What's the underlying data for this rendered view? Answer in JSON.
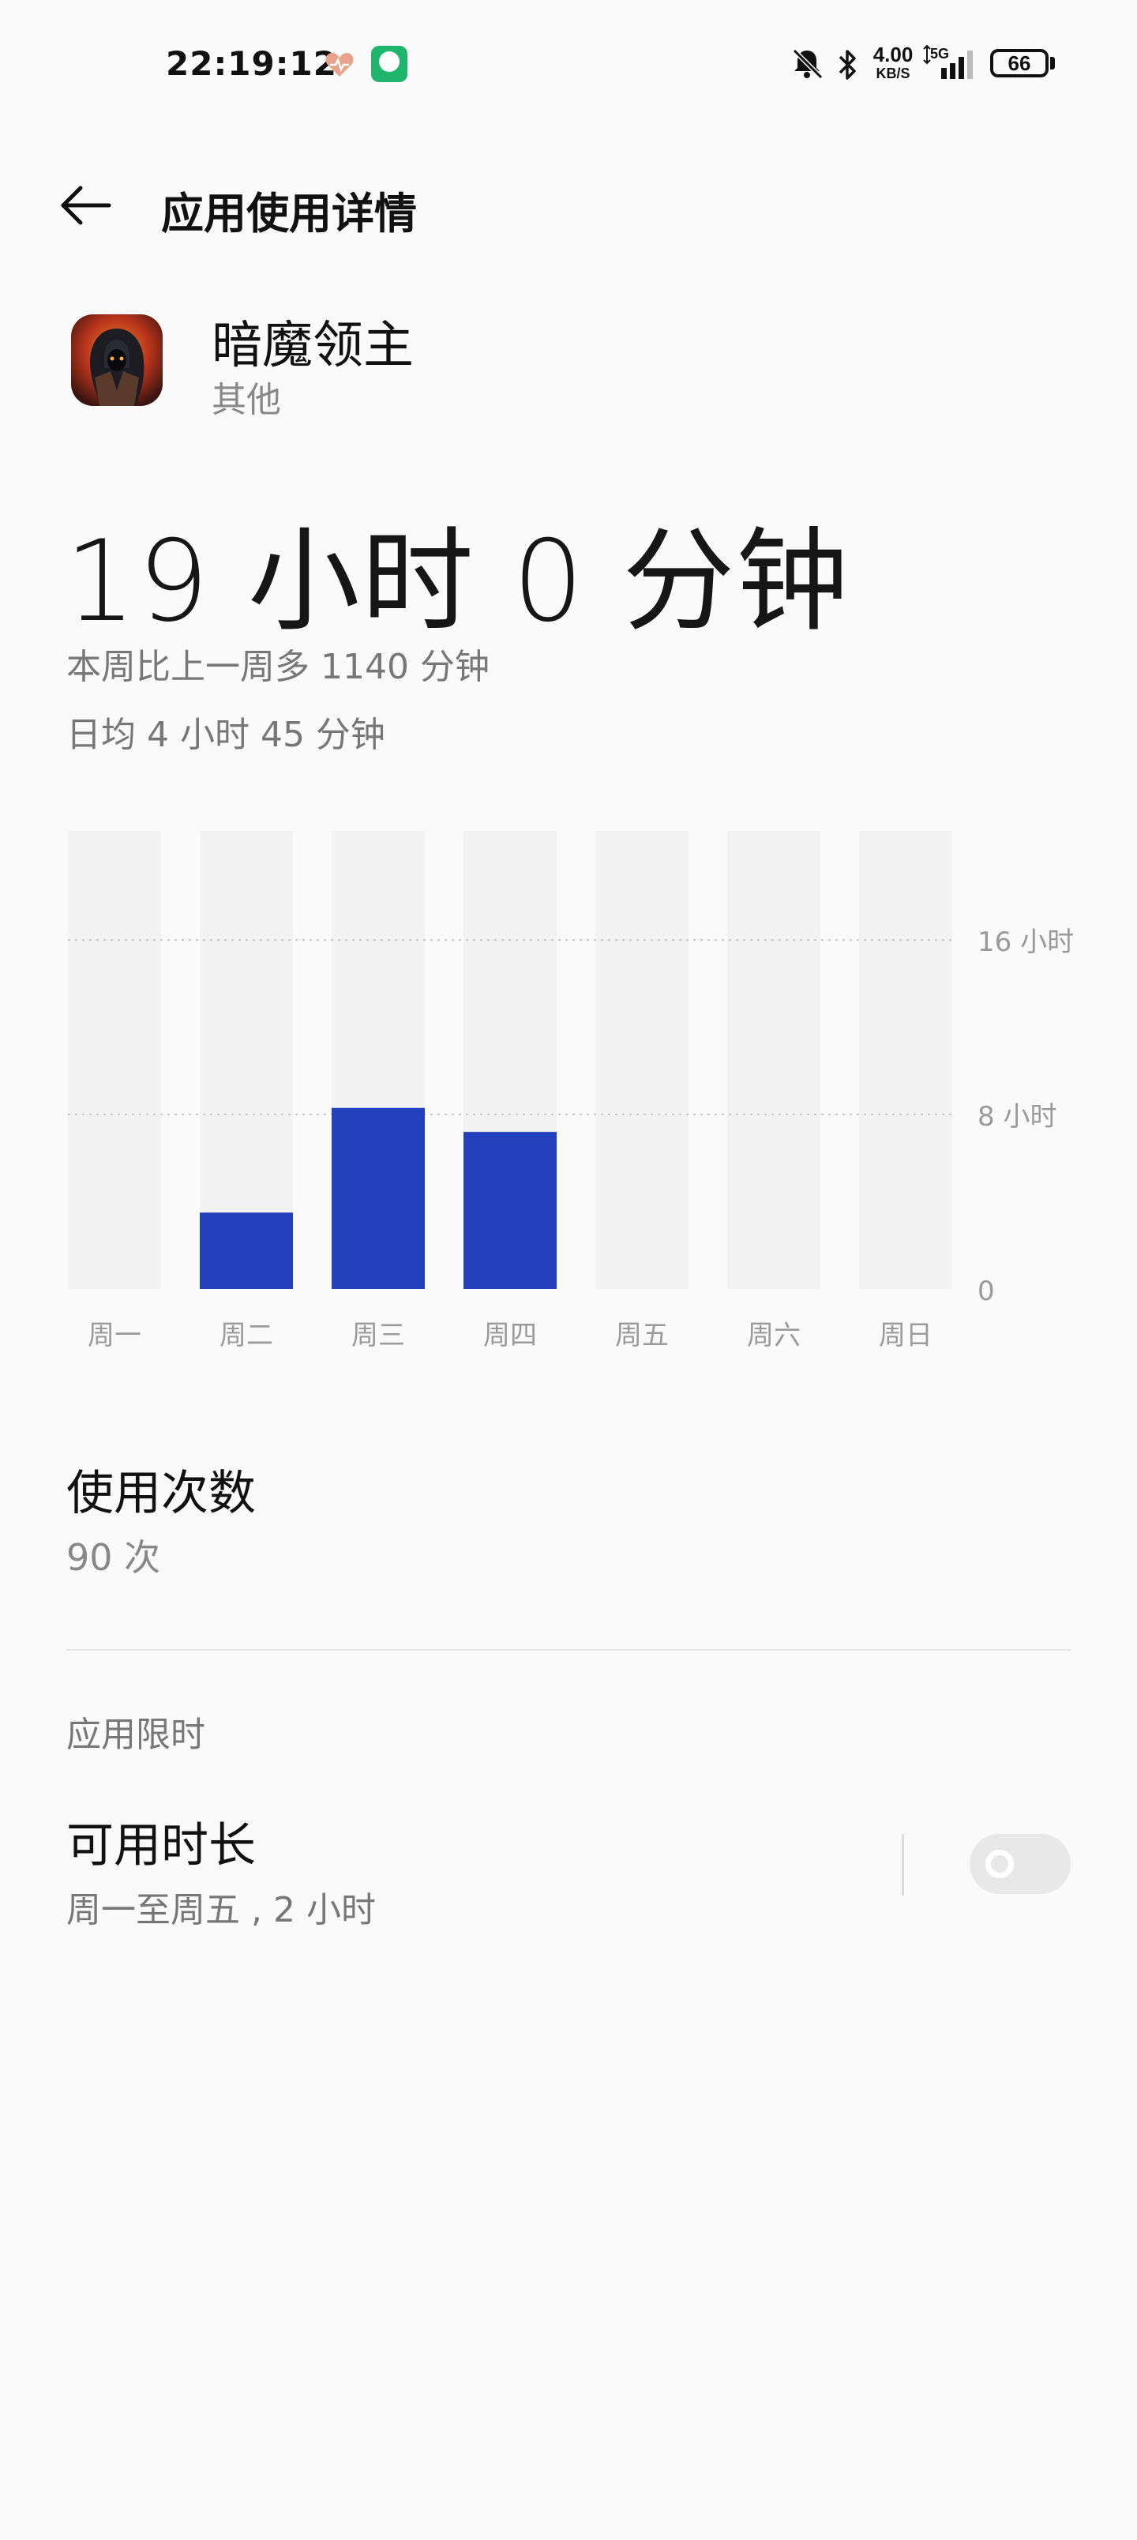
{
  "status_bar": {
    "time": "22:19:12",
    "net_speed_value": "4.00",
    "net_speed_unit": "KB/S",
    "network_type": "5G",
    "battery": "66",
    "icons": [
      "heart-health-icon",
      "app-notification-icon",
      "bell-mute-icon",
      "bluetooth-icon",
      "signal-icon",
      "battery-icon"
    ]
  },
  "header": {
    "title": "应用使用详情"
  },
  "app": {
    "name": "暗魔领主",
    "category": "其他"
  },
  "summary": {
    "total": "19 小时 0 分钟",
    "compare": "本周比上一周多 1140 分钟",
    "daily_average": "日均 4 小时 45 分钟"
  },
  "chart_data": {
    "type": "bar",
    "categories": [
      "周一",
      "周二",
      "周三",
      "周四",
      "周五",
      "周六",
      "周日"
    ],
    "values": [
      0,
      3.5,
      8.3,
      7.2,
      0,
      0,
      0
    ],
    "value_unit": "hours",
    "ylim": [
      0,
      21
    ],
    "yticks": [
      0,
      8,
      16
    ],
    "ytick_labels": [
      "0",
      "8 小时",
      "16 小时"
    ],
    "grid": "dotted horizontal at 8 and 16",
    "bar_color": "#2441bd",
    "track_color": "#f2f2f2"
  },
  "usage": {
    "title": "使用次数",
    "count": "90 次"
  },
  "limit": {
    "section_title": "应用限时",
    "title": "可用时长",
    "description": "周一至周五 , 2 小时",
    "toggle_on": false
  }
}
